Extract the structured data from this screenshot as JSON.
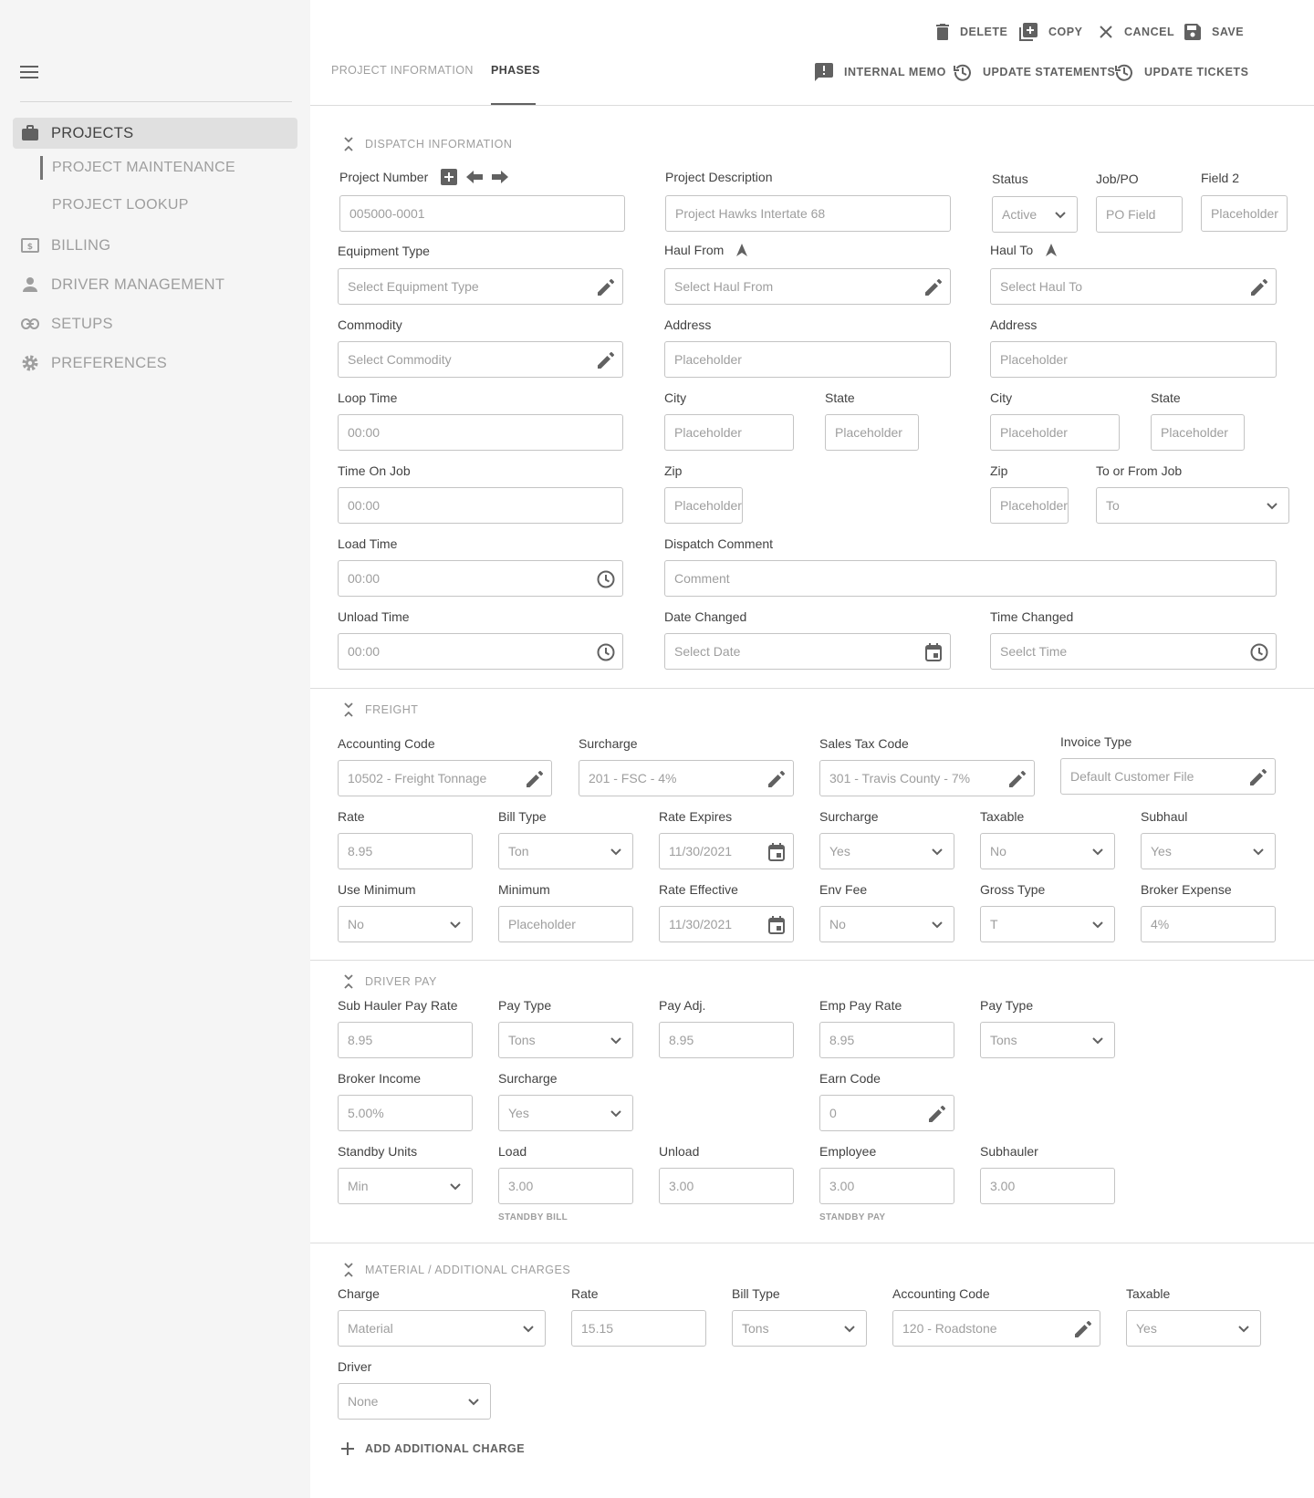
{
  "sidebar": {
    "items": [
      {
        "label": "PROJECTS",
        "icon": "briefcase-icon"
      },
      {
        "label": "BILLING",
        "icon": "billing-icon"
      },
      {
        "label": "DRIVER MANAGEMENT",
        "icon": "person-icon"
      },
      {
        "label": "SETUPS",
        "icon": "link-icon"
      },
      {
        "label": "PREFERENCES",
        "icon": "gear-icon"
      }
    ],
    "subitems": [
      {
        "label": "PROJECT MAINTENANCE"
      },
      {
        "label": "PROJECT LOOKUP"
      }
    ]
  },
  "toolbar": {
    "delete": "DELETE",
    "copy": "COPY",
    "cancel": "CANCEL",
    "save": "SAVE",
    "internal_memo": "INTERNAL MEMO",
    "update_statements": "UPDATE STATEMENTS",
    "update_tickets": "UPDATE TICKETS"
  },
  "tabs": [
    {
      "label": "PROJECT INFORMATION"
    },
    {
      "label": "PHASES"
    }
  ],
  "dispatch": {
    "title": "DISPATCH INFORMATION",
    "project_number": {
      "label": "Project Number",
      "placeholder": "005000-0001"
    },
    "project_description": {
      "label": "Project Description",
      "placeholder": "Project Hawks Intertate 68"
    },
    "status": {
      "label": "Status",
      "value": "Active"
    },
    "job_po": {
      "label": "Job/PO",
      "placeholder": "PO Field"
    },
    "field2": {
      "label": "Field 2",
      "placeholder": "Placeholder"
    },
    "equipment_type": {
      "label": "Equipment Type",
      "placeholder": "Select Equipment Type"
    },
    "haul_from": {
      "label": "Haul From",
      "placeholder": "Select Haul From"
    },
    "haul_to": {
      "label": "Haul To",
      "placeholder": "Select Haul To"
    },
    "commodity": {
      "label": "Commodity",
      "placeholder": "Select Commodity"
    },
    "from_address": {
      "label": "Address",
      "placeholder": "Placeholder"
    },
    "to_address": {
      "label": "Address",
      "placeholder": "Placeholder"
    },
    "loop_time": {
      "label": "Loop Time",
      "placeholder": "00:00"
    },
    "from_city": {
      "label": "City",
      "placeholder": "Placeholder"
    },
    "from_state": {
      "label": "State",
      "placeholder": "Placeholder"
    },
    "to_city": {
      "label": "City",
      "placeholder": "Placeholder"
    },
    "to_state": {
      "label": "State",
      "placeholder": "Placeholder"
    },
    "time_on_job": {
      "label": "Time On Job",
      "placeholder": "00:00"
    },
    "from_zip": {
      "label": "Zip",
      "placeholder": "Placeholder"
    },
    "to_zip": {
      "label": "Zip",
      "placeholder": "Placeholder"
    },
    "to_or_from_job": {
      "label": "To or From Job",
      "value": "To"
    },
    "load_time": {
      "label": "Load Time",
      "placeholder": "00:00"
    },
    "dispatch_comment": {
      "label": "Dispatch Comment",
      "placeholder": "Comment"
    },
    "unload_time": {
      "label": "Unload Time",
      "placeholder": "00:00"
    },
    "date_changed": {
      "label": "Date Changed",
      "placeholder": "Select Date"
    },
    "time_changed": {
      "label": "Time Changed",
      "placeholder": "Seelct Time"
    }
  },
  "freight": {
    "title": "FREIGHT",
    "accounting_code": {
      "label": "Accounting Code",
      "value": "10502 - Freight Tonnage"
    },
    "surcharge_code": {
      "label": "Surcharge",
      "value": "201 - FSC - 4%"
    },
    "sales_tax_code": {
      "label": "Sales Tax Code",
      "value": "301 - Travis County - 7%"
    },
    "invoice_type": {
      "label": "Invoice Type",
      "value": "Default Customer File"
    },
    "rate": {
      "label": "Rate",
      "value": "8.95"
    },
    "bill_type": {
      "label": "Bill Type",
      "value": "Ton"
    },
    "rate_expires": {
      "label": "Rate Expires",
      "value": "11/30/2021"
    },
    "surcharge": {
      "label": "Surcharge",
      "value": "Yes"
    },
    "taxable": {
      "label": "Taxable",
      "value": "No"
    },
    "subhaul": {
      "label": "Subhaul",
      "value": "Yes"
    },
    "use_minimum": {
      "label": "Use Minimum",
      "value": "No"
    },
    "minimum": {
      "label": "Minimum",
      "placeholder": "Placeholder"
    },
    "rate_effective": {
      "label": "Rate Effective",
      "value": "11/30/2021"
    },
    "env_fee": {
      "label": "Env Fee",
      "value": "No"
    },
    "gross_type": {
      "label": "Gross Type",
      "value": "T"
    },
    "broker_expense": {
      "label": "Broker Expense",
      "value": "4%"
    }
  },
  "driver_pay": {
    "title": "DRIVER PAY",
    "sub_hauler_pay_rate": {
      "label": "Sub Hauler Pay Rate",
      "value": "8.95"
    },
    "pay_type": {
      "label": "Pay Type",
      "value": "Tons"
    },
    "pay_adj": {
      "label": "Pay Adj.",
      "value": "8.95"
    },
    "emp_pay_rate": {
      "label": "Emp Pay Rate",
      "value": "8.95"
    },
    "emp_pay_type": {
      "label": "Pay Type",
      "value": "Tons"
    },
    "broker_income": {
      "label": "Broker Income",
      "value": "5.00%"
    },
    "surcharge": {
      "label": "Surcharge",
      "value": "Yes"
    },
    "earn_code": {
      "label": "Earn Code",
      "value": "0"
    },
    "standby_units": {
      "label": "Standby Units",
      "value": "Min"
    },
    "load": {
      "label": "Load",
      "value": "3.00"
    },
    "unload": {
      "label": "Unload",
      "value": "3.00"
    },
    "employee": {
      "label": "Employee",
      "value": "3.00"
    },
    "subhauler": {
      "label": "Subhauler",
      "value": "3.00"
    },
    "standby_bill_caption": "STANDBY BILL",
    "standby_pay_caption": "STANDBY PAY"
  },
  "material": {
    "title": "MATERIAL / ADDITIONAL CHARGES",
    "charge": {
      "label": "Charge",
      "value": "Material"
    },
    "rate": {
      "label": "Rate",
      "value": "15.15"
    },
    "bill_type": {
      "label": "Bill Type",
      "value": "Tons"
    },
    "accounting_code": {
      "label": "Accounting Code",
      "value": "120 - Roadstone"
    },
    "taxable": {
      "label": "Taxable",
      "value": "Yes"
    },
    "driver": {
      "label": "Driver",
      "value": "None"
    },
    "add_charge": "ADD ADDITIONAL CHARGE"
  }
}
